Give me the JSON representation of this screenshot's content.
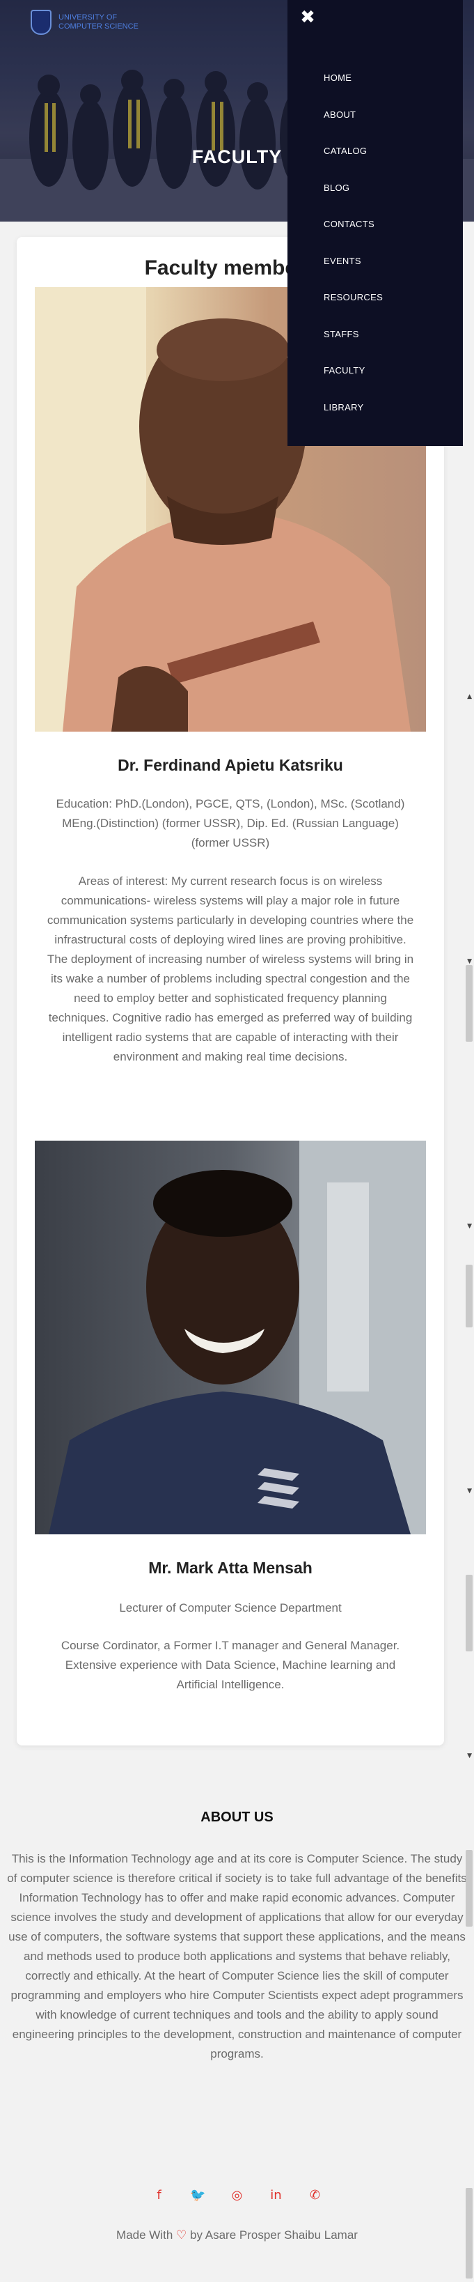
{
  "header": {
    "logo_text_line1": "UNIVERSITY OF",
    "logo_text_line2": "COMPUTER SCIENCE",
    "page_title": "FACULTY"
  },
  "nav": {
    "close_label": "✖",
    "items": [
      "HOME",
      "ABOUT",
      "CATALOG",
      "BLOG",
      "CONTACTS",
      "EVENTS",
      "RESOURCES",
      "STAFFS",
      "FACULTY",
      "LIBRARY"
    ]
  },
  "faculty": {
    "section_title": "Faculty members",
    "members": [
      {
        "name": "Dr. Ferdinand Apietu Katsriku",
        "education": "Education: PhD.(London), PGCE, QTS, (London), MSc. (Scotland) MEng.(Distinction) (former USSR), Dip. Ed. (Russian Language) (former USSR)",
        "interest": "Areas of interest: My current research focus is on wireless communications- wireless systems will play a major role in future communication systems particularly in developing countries where the infrastructural costs of deploying wired lines are proving prohibitive. The deployment of increasing number of wireless systems will bring in its wake a number of problems including spectral congestion and the need to employ better and sophisticated frequency planning techniques. Cognitive radio has emerged as preferred way of building intelligent radio systems that are capable of interacting with their environment and making real time decisions."
      },
      {
        "name": "Mr. Mark Atta Mensah",
        "role": "Lecturer of Computer Science Department",
        "bio": "Course Cordinator, a Former I.T manager and General Manager. Extensive experience with Data Science, Machine learning and Artificial Intelligence."
      }
    ]
  },
  "about": {
    "title": "ABOUT US",
    "text": "This is the Information Technology age and at its core is Computer Science. The study of computer science is therefore critical if society is to take full advantage of the benefits Information Technology has to offer and make rapid economic advances. Computer science involves the study and development of applications that allow for our everyday use of computers, the software systems that support these applications, and the means and methods used to produce both applications and systems that behave reliably, correctly and ethically. At the heart of Computer Science lies the skill of computer programming and employers who hire Computer Scientists expect adept programmers with knowledge of current techniques and tools and the ability to apply sound engineering principles to the development, construction and maintenance of computer programs."
  },
  "socials": {
    "facebook_icon": "f",
    "twitter_icon": "🐦",
    "instagram_icon": "◎",
    "linkedin_icon": "in",
    "whatsapp_icon": "✆"
  },
  "footer": {
    "made_with": "Made With",
    "heart": "♡",
    "credit": "by Asare Prosper Shaibu Lamar"
  },
  "colors": {
    "accent": "#e0302a",
    "nav_bg": "#0d0f24"
  }
}
